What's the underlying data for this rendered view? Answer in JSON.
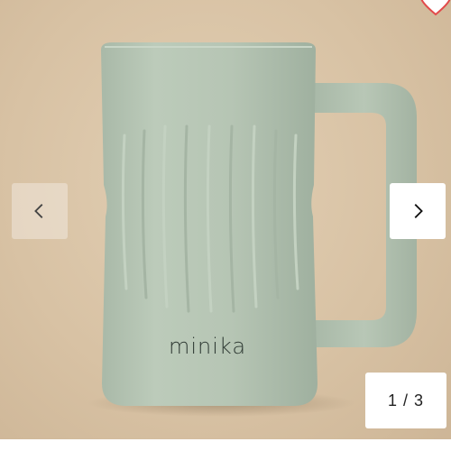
{
  "product": {
    "brand_text": "minika",
    "colors": {
      "background": "#d9c4a7",
      "mug_body": "#b7c6b5",
      "accent_heart": "#e24b4b"
    }
  },
  "gallery": {
    "prev_icon": "chevron-left-icon",
    "next_icon": "chevron-right-icon",
    "favorite_icon": "heart-icon",
    "counter": "1 / 3"
  }
}
